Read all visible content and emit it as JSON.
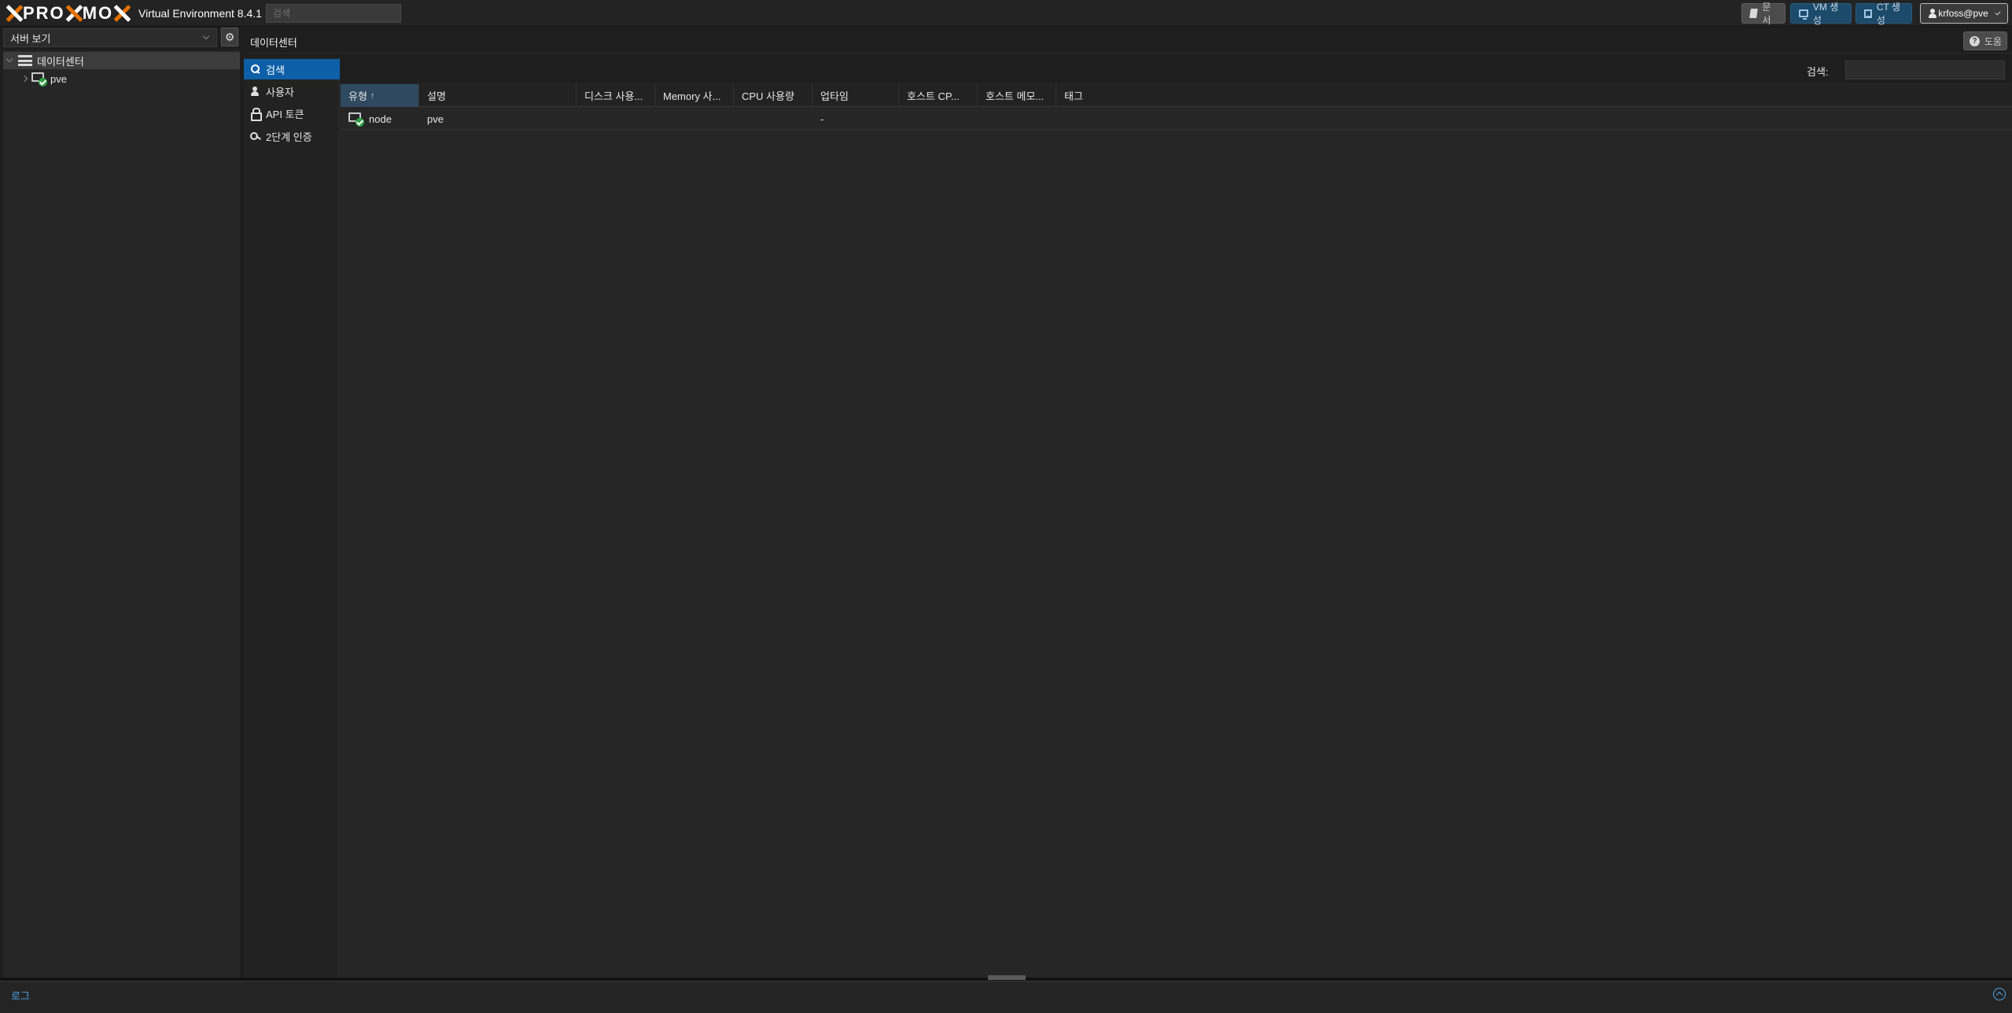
{
  "app": {
    "logo_text_a": "PRO",
    "logo_text_b": "MO",
    "version": "Virtual Environment 8.4.1",
    "search_placeholder": "검색"
  },
  "topbar": {
    "docs_label": "문서",
    "create_vm_label": "VM 생성",
    "create_ct_label": "CT 생성",
    "user_label": "krfoss@pve"
  },
  "left_panel": {
    "view_label": "서버 보기",
    "tree": {
      "datacenter_label": "데이터센터",
      "node_label": "pve"
    }
  },
  "content": {
    "title": "데이터센터",
    "help_label": "도움"
  },
  "menu": {
    "items": [
      {
        "label": "검색",
        "icon": "search-icon"
      },
      {
        "label": "사용자",
        "icon": "user-icon"
      },
      {
        "label": "API 토큰",
        "icon": "lock-icon"
      },
      {
        "label": "2단계 인증",
        "icon": "key-icon"
      }
    ]
  },
  "grid": {
    "search_label": "검색:",
    "columns": [
      {
        "label": "유형",
        "sort": "asc"
      },
      {
        "label": "설명"
      },
      {
        "label": "디스크 사용..."
      },
      {
        "label": "Memory 사..."
      },
      {
        "label": "CPU 사용량"
      },
      {
        "label": "업타임"
      },
      {
        "label": "호스트 CP..."
      },
      {
        "label": "호스트 메모..."
      },
      {
        "label": "태그"
      }
    ],
    "rows": [
      {
        "type": "node",
        "description": "pve",
        "disk": "",
        "memory": "",
        "cpu": "",
        "uptime": "-",
        "host_cpu": "",
        "host_memory": "",
        "tags": ""
      }
    ]
  },
  "log": {
    "label": "로그"
  },
  "colors": {
    "accent_blue": "#0d5fa8",
    "status_ok": "#2fa043",
    "logo_orange": "#e57000"
  }
}
